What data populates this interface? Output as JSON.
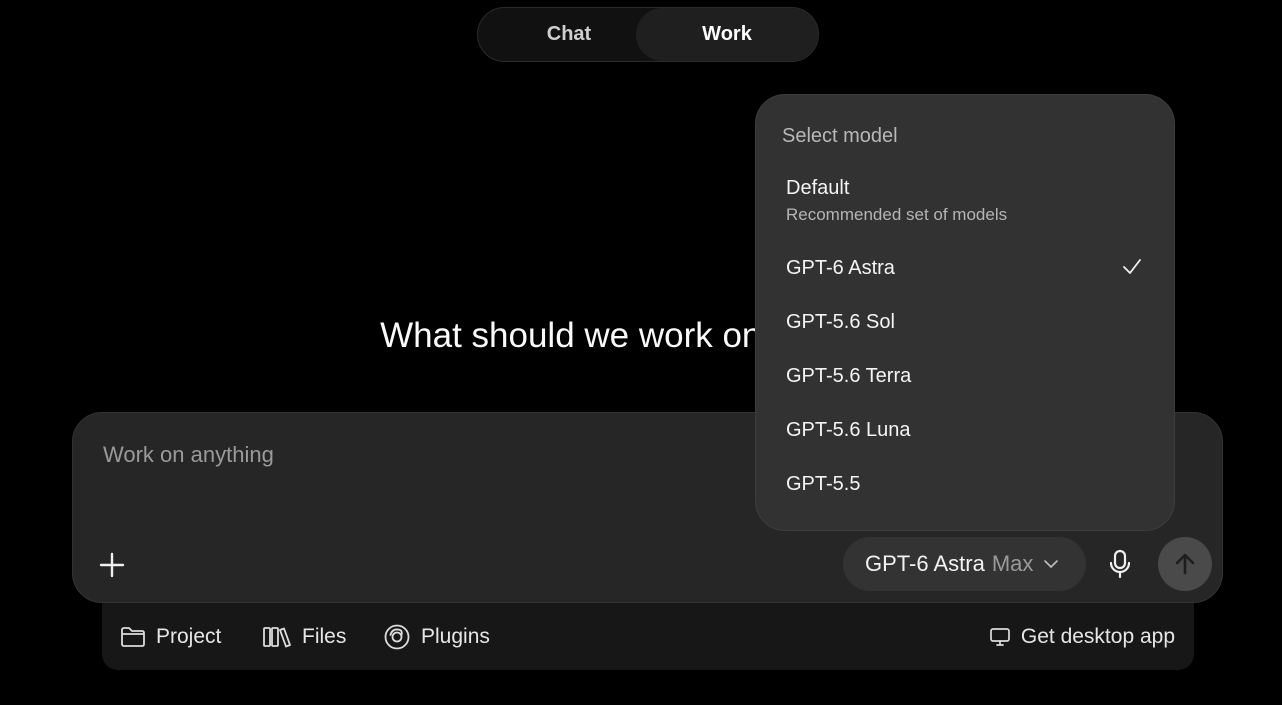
{
  "mode_toggle": {
    "chat_label": "Chat",
    "work_label": "Work",
    "active": "Work"
  },
  "heading": "What should we work on?",
  "composer": {
    "placeholder": "Work on anything",
    "model_name": "GPT-6 Astra",
    "model_effort": "Max"
  },
  "bottom_bar": {
    "project_label": "Project",
    "files_label": "Files",
    "plugins_label": "Plugins",
    "desktop_label": "Get desktop app"
  },
  "model_menu": {
    "title": "Select model",
    "items": [
      {
        "label": "Default",
        "description": "Recommended set of models",
        "selected": false
      },
      {
        "label": "GPT-6 Astra",
        "selected": true
      },
      {
        "label": "GPT-5.6 Sol",
        "selected": false
      },
      {
        "label": "GPT-5.6 Terra",
        "selected": false
      },
      {
        "label": "GPT-5.6 Luna",
        "selected": false
      },
      {
        "label": "GPT-5.5",
        "selected": false
      }
    ]
  }
}
